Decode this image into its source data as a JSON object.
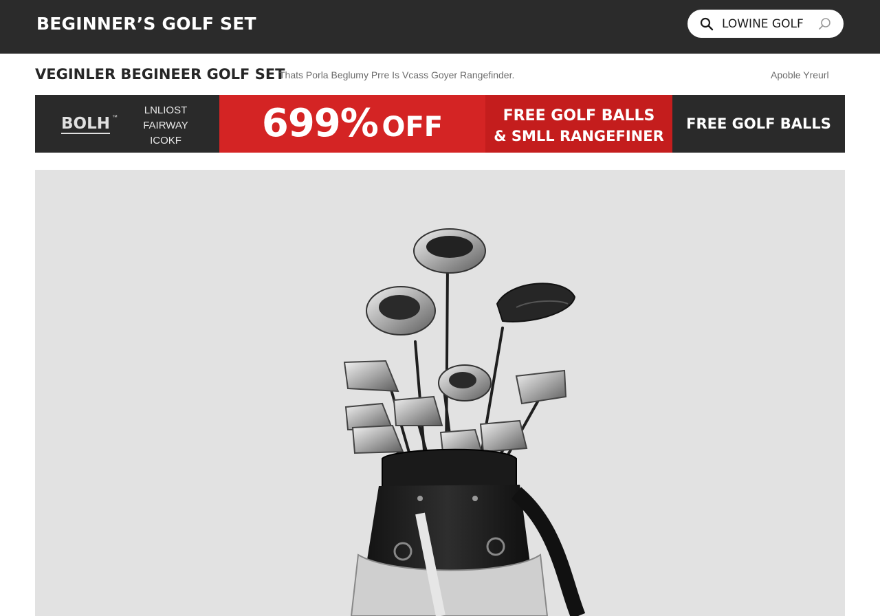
{
  "header": {
    "site_title": "BEGINNER’S GOLF SET",
    "search": {
      "value": "LOWINE GOLF",
      "icon": "search-icon",
      "mic_icon": "search-alt-icon"
    }
  },
  "subheader": {
    "product_title": "VEGINLER BEGINEER GOLF SET",
    "product_description": "Thats Porla Beglumy Prre Is Vcass Goyer Rangefinder.",
    "aux_link": "Apoble Yreurl"
  },
  "promo_banner": {
    "brand_logo": "BOLH",
    "brand_tm": "™",
    "brand_lines": [
      "LNLIOST",
      "FAIRWAY",
      "ICOKF"
    ],
    "discount_value": "699%",
    "discount_label": "OFF",
    "offer_line1": "FREE GOLF BALLS",
    "offer_line2": "& SMLL RANGEFINER",
    "free_balls": "FREE GOLF BALLS",
    "colors": {
      "dark": "#2a2a2a",
      "red": "#d42424",
      "red_dark": "#c41d1d"
    }
  },
  "hero": {
    "image_alt": "golf-club-set-in-black-bag"
  }
}
